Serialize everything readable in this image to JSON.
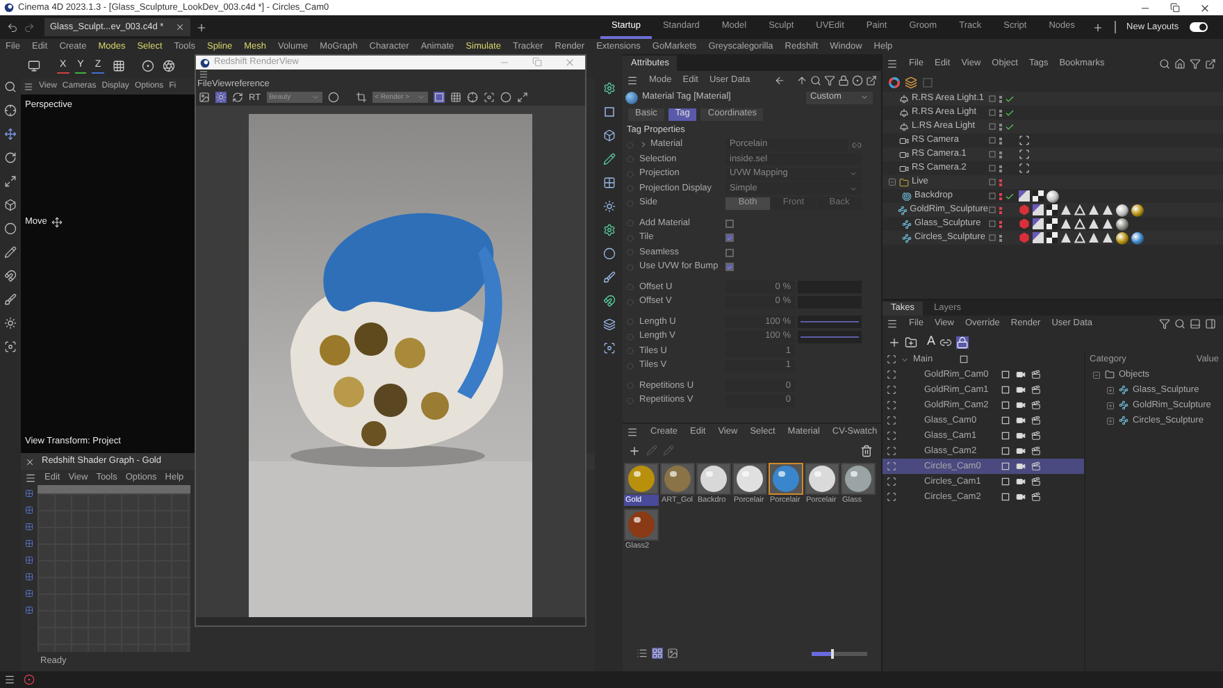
{
  "window": {
    "title": "Cinema 4D 2023.1.3 - [Glass_Sculpture_LookDev_003.c4d *] - Circles_Cam0"
  },
  "document_tab": {
    "label": "Glass_Sculpt...ev_003.c4d *"
  },
  "layouts": [
    {
      "label": "Startup",
      "selected": true
    },
    {
      "label": "Standard",
      "selected": false
    },
    {
      "label": "Model",
      "selected": false
    },
    {
      "label": "Sculpt",
      "selected": false
    },
    {
      "label": "UVEdit",
      "selected": false
    },
    {
      "label": "Paint",
      "selected": false
    },
    {
      "label": "Groom",
      "selected": false
    },
    {
      "label": "Track",
      "selected": false
    },
    {
      "label": "Script",
      "selected": false
    },
    {
      "label": "Nodes",
      "selected": false
    }
  ],
  "new_layouts": {
    "label": "New Layouts",
    "on": true
  },
  "main_menu": [
    {
      "label": "File",
      "highlighted": false
    },
    {
      "label": "Edit",
      "highlighted": false
    },
    {
      "label": "Create",
      "highlighted": false
    },
    {
      "label": "Modes",
      "highlighted": true
    },
    {
      "label": "Select",
      "highlighted": true
    },
    {
      "label": "Tools",
      "highlighted": false
    },
    {
      "label": "Spline",
      "highlighted": true
    },
    {
      "label": "Mesh",
      "highlighted": true
    },
    {
      "label": "Volume",
      "highlighted": false
    },
    {
      "label": "MoGraph",
      "highlighted": false
    },
    {
      "label": "Character",
      "highlighted": false
    },
    {
      "label": "Animate",
      "highlighted": false
    },
    {
      "label": "Simulate",
      "highlighted": true
    },
    {
      "label": "Tracker",
      "highlighted": false
    },
    {
      "label": "Render",
      "highlighted": false
    },
    {
      "label": "Extensions",
      "highlighted": false
    },
    {
      "label": "GoMarkets",
      "highlighted": false
    },
    {
      "label": "Greyscalegorilla",
      "highlighted": false
    },
    {
      "label": "Redshift",
      "highlighted": false
    },
    {
      "label": "Window",
      "highlighted": false
    },
    {
      "label": "Help",
      "highlighted": false
    }
  ],
  "toolbar": {
    "axes": [
      "X",
      "Y",
      "Z"
    ]
  },
  "viewport": {
    "menu": [
      "View",
      "Cameras",
      "Display",
      "Options",
      "Fi"
    ],
    "camera": "Perspective",
    "tool": "Move",
    "view_transform": "View Transform: Project"
  },
  "shader_graph": {
    "title": "Redshift Shader Graph - Gold",
    "menu": [
      "Edit",
      "View",
      "Tools",
      "Options",
      "Help"
    ],
    "status": "Ready"
  },
  "render_view": {
    "title": "Redshift RenderView",
    "menu": "FileViewreference",
    "rt": "RT",
    "aov": "Beauty",
    "camera": "< Render >"
  },
  "attributes": {
    "tab": "Attributes",
    "menu": [
      "Mode",
      "Edit",
      "User Data"
    ],
    "object": "Material Tag [Material]",
    "mode": "Custom",
    "tabs": [
      {
        "label": "Basic",
        "selected": false
      },
      {
        "label": "Tag",
        "selected": true
      },
      {
        "label": "Coordinates",
        "selected": false
      }
    ],
    "section": "Tag Properties",
    "groups": [
      [
        {
          "kind": "link",
          "label": "Material",
          "value": "Porcelain"
        },
        {
          "kind": "text",
          "label": "Selection",
          "value": "inside.sel"
        },
        {
          "kind": "dropdown",
          "label": "Projection",
          "value": "UVW Mapping"
        },
        {
          "kind": "dropdown",
          "label": "Projection Display",
          "value": "Simple"
        },
        {
          "kind": "segmented",
          "label": "Side",
          "options": [
            {
              "label": "Both",
              "selected": true
            },
            {
              "label": "Front",
              "selected": false
            },
            {
              "label": "Back",
              "selected": false
            }
          ]
        }
      ],
      [
        {
          "kind": "checkbox",
          "label": "Add Material",
          "checked": false
        },
        {
          "kind": "checkbox",
          "label": "Tile",
          "checked": true
        },
        {
          "kind": "checkbox",
          "label": "Seamless",
          "checked": false
        },
        {
          "kind": "checkbox",
          "label": "Use UVW for Bump",
          "checked": true
        }
      ],
      [
        {
          "kind": "slider",
          "label": "Offset U",
          "value": "0 %",
          "level": 0
        },
        {
          "kind": "slider",
          "label": "Offset V",
          "value": "0 %",
          "level": 0
        }
      ],
      [
        {
          "kind": "slider",
          "label": "Length U",
          "value": "100 %",
          "level": 1
        },
        {
          "kind": "slider",
          "label": "Length V",
          "value": "100 %",
          "level": 1
        },
        {
          "kind": "number",
          "label": "Tiles U",
          "value": "1"
        },
        {
          "kind": "number",
          "label": "Tiles V",
          "value": "1"
        }
      ],
      [
        {
          "kind": "number",
          "label": "Repetitions U",
          "value": "0"
        },
        {
          "kind": "number",
          "label": "Repetitions V",
          "value": "0"
        }
      ]
    ]
  },
  "materials": {
    "menu": [
      "Create",
      "Edit",
      "View",
      "Select",
      "Material",
      "CV-Swatch"
    ],
    "items": [
      {
        "name": "Gold",
        "color": "#b8900c",
        "selected": true,
        "linked": false
      },
      {
        "name": "ART_Gol",
        "color": "#8a7346",
        "selected": false,
        "linked": false
      },
      {
        "name": "Backdro",
        "color": "#d8d8d8",
        "selected": false,
        "linked": false
      },
      {
        "name": "Porcelair",
        "color": "#e0e0e0",
        "selected": false,
        "linked": false
      },
      {
        "name": "Porcelair",
        "color": "#3a86cc",
        "selected": false,
        "linked": true
      },
      {
        "name": "Porcelair",
        "color": "#dadada",
        "selected": false,
        "linked": false
      },
      {
        "name": "Glass",
        "color": "#9aa4a4",
        "selected": false,
        "linked": false
      },
      {
        "name": "Glass2",
        "color": "#8a3a14",
        "selected": false,
        "linked": false
      }
    ],
    "zoom": {
      "level": 0.35
    }
  },
  "objects": {
    "menu": [
      "File",
      "Edit",
      "View",
      "Object",
      "Tags",
      "Bookmarks"
    ],
    "items": [
      {
        "name": "R.RS Area Light.1",
        "kind": "light",
        "color": "#8a8a8a",
        "checked": true
      },
      {
        "name": "R.RS Area Light",
        "kind": "light",
        "color": "#8a8a8a",
        "checked": true
      },
      {
        "name": "L.RS Area Light",
        "kind": "light",
        "color": "#8a8a8a",
        "checked": true
      },
      {
        "name": "RS Camera",
        "kind": "camera",
        "color": "#8a8a8a",
        "checked": false,
        "tags": [
          {
            "kind": "view"
          }
        ]
      },
      {
        "name": "RS Camera.1",
        "kind": "camera",
        "color": "#8a8a8a",
        "checked": false,
        "tags": [
          {
            "kind": "view"
          }
        ]
      },
      {
        "name": "RS Camera.2",
        "kind": "camera",
        "color": "#8a8a8a",
        "checked": false,
        "tags": [
          {
            "kind": "view"
          }
        ]
      },
      {
        "name": "Live",
        "kind": "folder",
        "color": "#e0404e",
        "checked": false,
        "expanded": true,
        "children": [
          {
            "name": "Backdrop",
            "kind": "backdrop",
            "color": "#e0404e",
            "checked": true,
            "tags": [
              {
                "kind": "texture"
              },
              {
                "kind": "checker"
              },
              {
                "kind": "sphere-grey"
              }
            ]
          },
          {
            "name": "GoldRim_Sculpture",
            "kind": "sculpture",
            "color": "#e0404e",
            "checked": false,
            "tags": [
              {
                "kind": "phong"
              },
              {
                "kind": "texture"
              },
              {
                "kind": "checker"
              },
              {
                "kind": "triangle"
              },
              {
                "kind": "triangle-outline"
              },
              {
                "kind": "triangle"
              },
              {
                "kind": "triangle"
              },
              {
                "kind": "sphere-grey"
              },
              {
                "kind": "sphere-gold"
              }
            ]
          },
          {
            "name": "Glass_Sculpture",
            "kind": "sculpture",
            "color": "#e0404e",
            "checked": false,
            "tags": [
              {
                "kind": "phong"
              },
              {
                "kind": "texture"
              },
              {
                "kind": "checker"
              },
              {
                "kind": "triangle"
              },
              {
                "kind": "triangle-outline"
              },
              {
                "kind": "triangle"
              },
              {
                "kind": "triangle"
              },
              {
                "kind": "sphere-glass"
              }
            ]
          },
          {
            "name": "Circles_Sculpture",
            "kind": "sculpture",
            "color": "#8a8a8a",
            "checked": false,
            "tags": [
              {
                "kind": "phong"
              },
              {
                "kind": "texture"
              },
              {
                "kind": "checker"
              },
              {
                "kind": "triangle"
              },
              {
                "kind": "triangle-outline"
              },
              {
                "kind": "triangle"
              },
              {
                "kind": "triangle"
              },
              {
                "kind": "sphere-gold"
              },
              {
                "kind": "sphere-blue"
              }
            ]
          }
        ]
      }
    ]
  },
  "takes": {
    "tabs": [
      {
        "label": "Takes",
        "selected": true
      },
      {
        "label": "Layers",
        "selected": false
      }
    ],
    "menu": [
      "File",
      "View",
      "Override",
      "Render",
      "User Data"
    ],
    "auto_take": "A",
    "root": {
      "name": "Main",
      "expanded": true,
      "children": [
        {
          "name": "GoldRim_Cam0",
          "selected": false
        },
        {
          "name": "GoldRim_Cam1",
          "selected": false
        },
        {
          "name": "GoldRim_Cam2",
          "selected": false
        },
        {
          "name": "Glass_Cam0",
          "selected": false
        },
        {
          "name": "Glass_Cam1",
          "selected": false
        },
        {
          "name": "Glass_Cam2",
          "selected": false
        },
        {
          "name": "Circles_Cam0",
          "selected": true
        },
        {
          "name": "Circles_Cam1",
          "selected": false
        },
        {
          "name": "Circles_Cam2",
          "selected": false
        }
      ]
    },
    "overrides": {
      "columns": [
        "Category",
        "Value"
      ],
      "root": {
        "name": "Objects",
        "expanded": true,
        "children": [
          {
            "name": "Glass_Sculpture",
            "expanded": false
          },
          {
            "name": "GoldRim_Sculpture",
            "expanded": false
          },
          {
            "name": "Circles_Sculpture",
            "expanded": false
          }
        ]
      }
    }
  }
}
